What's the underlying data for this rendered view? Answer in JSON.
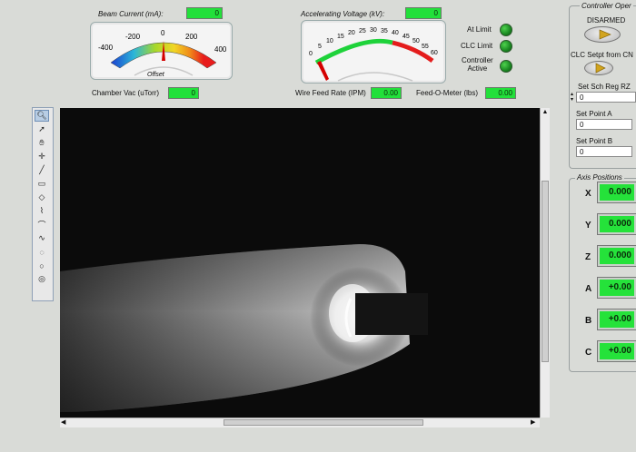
{
  "gauges": {
    "beam_current": {
      "label": "Beam Current (mA):",
      "readout": "0",
      "ticks": [
        "-400",
        "-200",
        "0",
        "200",
        "400"
      ],
      "caption": "Offset",
      "value": 0,
      "min": -400,
      "max": 400
    },
    "accel_voltage": {
      "label": "Accelerating Voltage (kV):",
      "readout": "0",
      "ticks": [
        "0",
        "5",
        "10",
        "15",
        "20",
        "25",
        "30",
        "35",
        "40",
        "45",
        "50",
        "55",
        "60"
      ],
      "value": 0,
      "min": 0,
      "max": 60
    }
  },
  "indicators": [
    {
      "label": "At Limit"
    },
    {
      "label": "CLC Limit"
    },
    {
      "label": "Controller\nActive"
    }
  ],
  "readouts": {
    "chamber_vac": {
      "label": "Chamber Vac (uTorr)",
      "value": "0"
    },
    "wire_feed": {
      "label": "Wire Feed Rate (IPM)",
      "value": "0.00"
    },
    "feed_o_meter": {
      "label": "Feed-O-Meter (lbs)",
      "value": "0.00"
    }
  },
  "controller": {
    "title": "Controller Oper",
    "disarmed_label": "DISARMED",
    "clc_label": "CLC Setpt from CN",
    "set_sch_label": "Set Sch Reg RZ",
    "set_sch_value": "0",
    "set_point_a_label": "Set Point A",
    "set_point_a_value": "0",
    "set_point_b_label": "Set Point B",
    "set_point_b_value": "0"
  },
  "axis": {
    "title": "Axis Positions",
    "rows": [
      {
        "letter": "X",
        "value": "0.000"
      },
      {
        "letter": "Y",
        "value": "0.000"
      },
      {
        "letter": "Z",
        "value": "0.000"
      },
      {
        "letter": "A",
        "value": "+0.00"
      },
      {
        "letter": "B",
        "value": "+0.00"
      },
      {
        "letter": "C",
        "value": "+0.00"
      }
    ]
  },
  "tools": [
    "zoom-icon",
    "pointer-icon",
    "pan-hand-icon",
    "crosshair-icon",
    "line-icon",
    "rectangle-icon",
    "rotated-rect-icon",
    "polyline-icon",
    "freehand-icon",
    "broken-line-icon",
    "lasso-icon",
    "oval-icon",
    "annulus-icon"
  ],
  "colors": {
    "lcd_green": "#22e03a",
    "background": "#d9dbd7",
    "needle": "#d40000"
  }
}
